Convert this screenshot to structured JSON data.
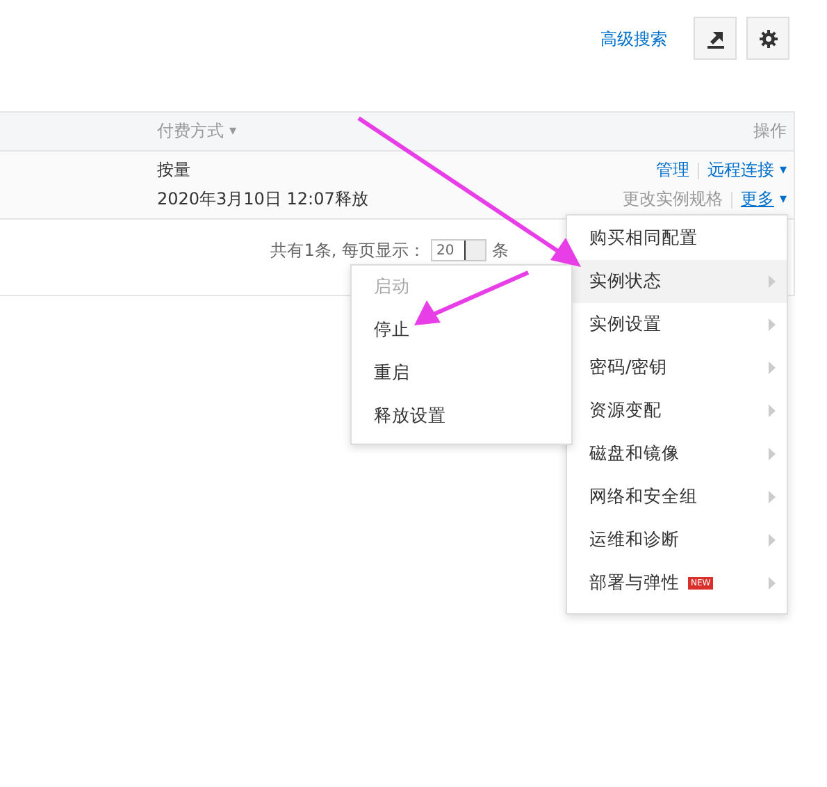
{
  "toolbar": {
    "advanced_search": "高级搜索"
  },
  "table": {
    "columns": [
      {
        "label": "付费方式",
        "sort_icon": "▾"
      },
      {
        "label": "操作"
      }
    ],
    "rows": [
      {
        "billing": "按量",
        "release": "2020年3月10日 12:07释放",
        "actions": [
          {
            "label": "管理",
            "disabled": false
          },
          {
            "label": "远程连接",
            "caret": "▾",
            "disabled": false
          }
        ],
        "actions2": [
          {
            "label": "更改实例规格",
            "disabled": true
          },
          {
            "label": "更多",
            "caret": "▾",
            "disabled": false
          }
        ]
      }
    ]
  },
  "pagination": {
    "total": "共有1条, 每页显示：",
    "page_size": "20",
    "unit": "条"
  },
  "menu": {
    "items": [
      {
        "label": "购买相同配置",
        "submenu": false,
        "selected": false
      },
      {
        "label": "实例状态",
        "submenu": true,
        "selected": true
      },
      {
        "label": "实例设置",
        "submenu": true,
        "selected": false
      },
      {
        "label": "密码/密钥",
        "submenu": true,
        "selected": false
      },
      {
        "label": "资源变配",
        "submenu": true,
        "selected": false
      },
      {
        "label": "磁盘和镜像",
        "submenu": true,
        "selected": false
      },
      {
        "label": "网络和安全组",
        "submenu": true,
        "selected": false
      },
      {
        "label": "运维和诊断",
        "submenu": true,
        "selected": false
      },
      {
        "label": "部署与弹性",
        "submenu": true,
        "selected": false,
        "badge": "NEW"
      }
    ]
  },
  "submenu": {
    "items": [
      {
        "label": "启动",
        "disabled": true
      },
      {
        "label": "停止",
        "disabled": false
      },
      {
        "label": "重启",
        "disabled": false
      },
      {
        "label": "释放设置",
        "disabled": false
      }
    ]
  }
}
